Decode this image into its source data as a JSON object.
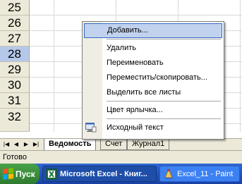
{
  "rows": [
    {
      "num": "25",
      "selected": false
    },
    {
      "num": "26",
      "selected": false
    },
    {
      "num": "27",
      "selected": false
    },
    {
      "num": "28",
      "selected": true
    },
    {
      "num": "29",
      "selected": false
    },
    {
      "num": "30",
      "selected": false
    },
    {
      "num": "31",
      "selected": false
    },
    {
      "num": "32",
      "selected": false
    }
  ],
  "context_menu": {
    "add": "Добавить...",
    "delete": "Удалить",
    "rename": "Переименовать",
    "move_copy": "Переместить/скопировать...",
    "select_all": "Выделить все листы",
    "tab_color": "Цвет ярлычка...",
    "view_code": "Исходный текст"
  },
  "sheet_tabs": [
    "Ведомость",
    "Счет",
    "Журнал1"
  ],
  "active_tab": "Ведомость",
  "status_bar": {
    "text": "Готово"
  },
  "taskbar": {
    "start": "Пуск",
    "items": [
      "Microsoft Excel - Книг...",
      "Excel_11 - Paint"
    ]
  },
  "colors": {
    "accent": "#316ac5",
    "selected_row": "#b6c8ea",
    "taskbar": "#245edb",
    "start": "#3c8f3d"
  }
}
